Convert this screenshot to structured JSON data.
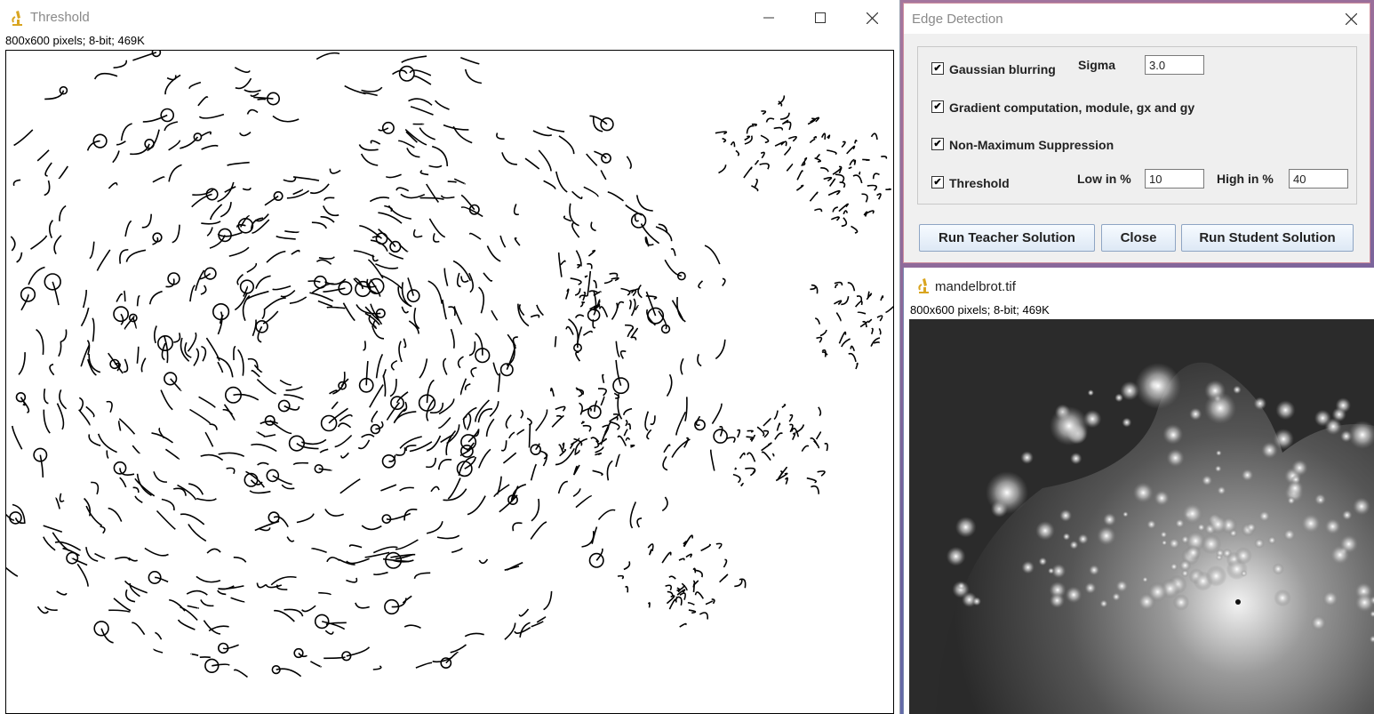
{
  "threshold_window": {
    "title": "Threshold",
    "info": "800x600 pixels; 8-bit; 469K"
  },
  "edge_dialog": {
    "title": "Edge Detection",
    "gaussian_label": "Gaussian blurring",
    "gaussian_checked": true,
    "sigma_label": "Sigma",
    "sigma_value": "3.0",
    "gradient_label": "Gradient computation, module, gx and gy",
    "gradient_checked": true,
    "nms_label": "Non-Maximum Suppression",
    "nms_checked": true,
    "threshold_label": "Threshold",
    "threshold_checked": true,
    "low_label": "Low in %",
    "low_value": "10",
    "high_label": "High in %",
    "high_value": "40",
    "check_mark": "✔",
    "buttons": {
      "teacher": "Run Teacher Solution",
      "close": "Close",
      "student": "Run Student Solution"
    }
  },
  "mandel_window": {
    "title": "mandelbrot.tif",
    "info": "800x600 pixels; 8-bit; 469K"
  },
  "colors": {
    "icon_yellow": "#d9a520",
    "button_border": "#8ea5c4",
    "dialog_border": "#cf8f9e"
  }
}
